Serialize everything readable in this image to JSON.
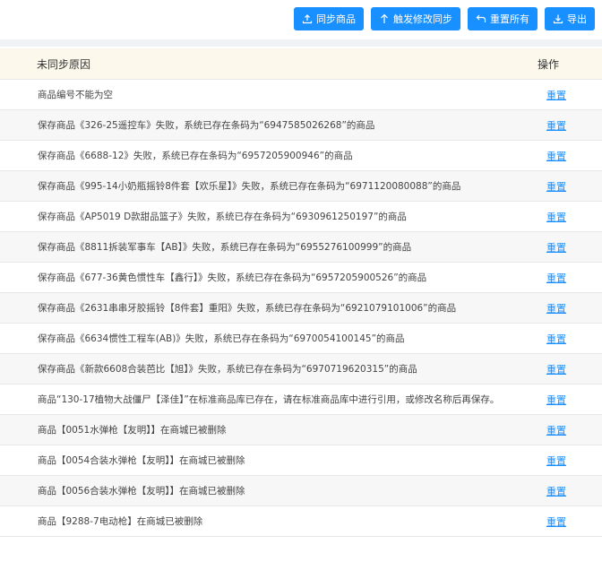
{
  "toolbar": {
    "sync_label": "同步商品",
    "trigger_label": "触发修改同步",
    "reset_all_label": "重置所有",
    "export_label": "导出"
  },
  "table": {
    "headers": {
      "reason": "未同步原因",
      "action": "操作"
    },
    "rows": [
      {
        "reason": "商品编号不能为空",
        "action": "重置"
      },
      {
        "reason": "保存商品《326-25遥控车》失败，系统已存在条码为“6947585026268”的商品",
        "action": "重置"
      },
      {
        "reason": "保存商品《6688-12》失败，系统已存在条码为“6957205900946”的商品",
        "action": "重置"
      },
      {
        "reason": "保存商品《995-14小奶瓶摇铃8件套【欢乐星】》失败，系统已存在条码为“6971120080088”的商品",
        "action": "重置"
      },
      {
        "reason": "保存商品《AP5019 D款甜品篮子》失败，系统已存在条码为“6930961250197”的商品",
        "action": "重置"
      },
      {
        "reason": "保存商品《8811拆装军事车【AB】》失败，系统已存在条码为“6955276100999”的商品",
        "action": "重置"
      },
      {
        "reason": "保存商品《677-36黄色惯性车【鑫行】》失败，系统已存在条码为“6957205900526”的商品",
        "action": "重置"
      },
      {
        "reason": "保存商品《2631串串牙胶摇铃【8件套】重阳》失败，系统已存在条码为“6921079101006”的商品",
        "action": "重置"
      },
      {
        "reason": "保存商品《6634惯性工程车(AB)》失败，系统已存在条码为“6970054100145”的商品",
        "action": "重置"
      },
      {
        "reason": "保存商品《新款6608合装芭比【旭】》失败，系统已存在条码为“6970719620315”的商品",
        "action": "重置"
      },
      {
        "reason": "商品“130-17植物大战僵尸【泽佳】”在标准商品库已存在，请在标准商品库中进行引用，或修改名称后再保存。",
        "action": "重置"
      },
      {
        "reason": "商品【0051水弹枪【友明】】在商城已被删除",
        "action": "重置"
      },
      {
        "reason": "商品【0054合装水弹枪【友明】】在商城已被删除",
        "action": "重置"
      },
      {
        "reason": "商品【0056合装水弹枪【友明】】在商城已被删除",
        "action": "重置"
      },
      {
        "reason": "商品【9288-7电动枪】在商城已被删除",
        "action": "重置"
      }
    ]
  }
}
